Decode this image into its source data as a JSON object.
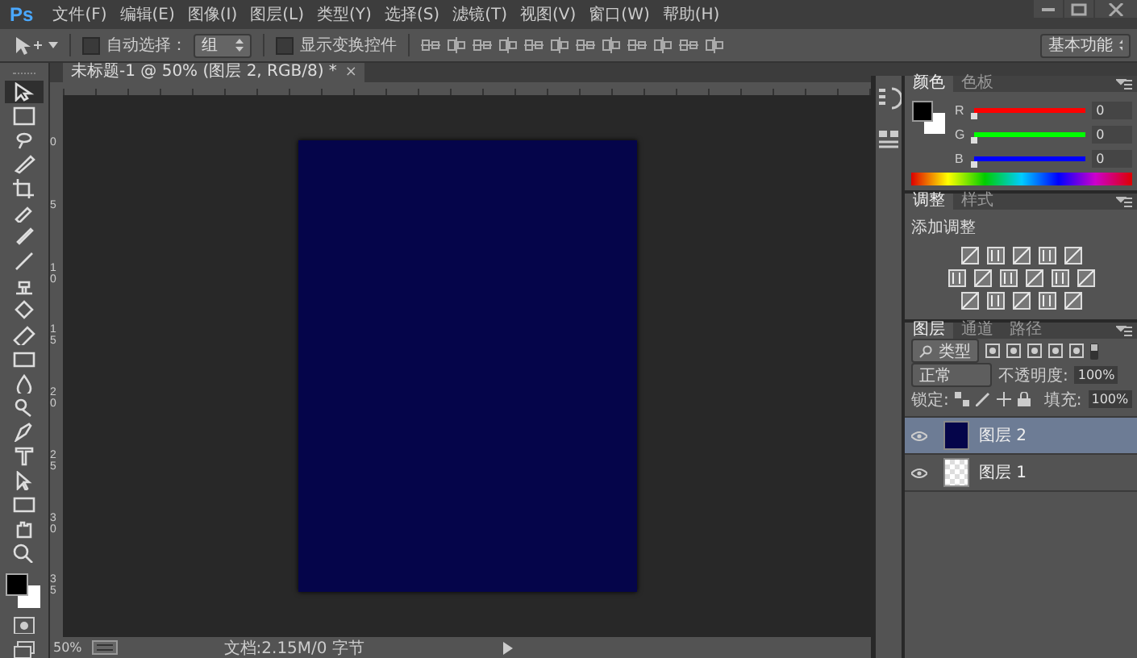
{
  "app_logo": "Ps",
  "menu": [
    "文件(F)",
    "编辑(E)",
    "图像(I)",
    "图层(L)",
    "类型(Y)",
    "选择(S)",
    "滤镜(T)",
    "视图(V)",
    "窗口(W)",
    "帮助(H)"
  ],
  "options_bar": {
    "auto_select": {
      "label": "自动选择：",
      "checked": false
    },
    "target": "组",
    "show_transform": {
      "label": "显示变换控件",
      "checked": false
    },
    "workspace": "基本功能"
  },
  "document_tab": {
    "title": "未标题-1 @ 50% (图层 2, RGB/8) *",
    "close": "×"
  },
  "tools": [
    {
      "selected": true
    },
    {
      "selected": false
    },
    {
      "selected": false
    },
    {
      "selected": false
    },
    {
      "selected": false
    },
    {
      "selected": false
    },
    {
      "selected": false
    },
    {
      "selected": false
    },
    {
      "selected": false
    },
    {
      "selected": false
    },
    {
      "selected": false
    },
    {
      "selected": false
    },
    {
      "selected": false
    },
    {
      "selected": false
    },
    {
      "selected": false
    },
    {
      "selected": false
    },
    {
      "selected": false
    },
    {
      "selected": false
    },
    {
      "selected": false
    },
    {
      "selected": false
    }
  ],
  "ruler_labels": [
    "0",
    "5",
    "10",
    "15",
    "20",
    "25",
    "30",
    "35"
  ],
  "color_panel": {
    "tabs": [
      {
        "label": "颜色",
        "selected": true
      },
      {
        "label": "色板",
        "selected": false
      }
    ],
    "channels": [
      {
        "name": "R",
        "value": "0",
        "level": 0,
        "color": "#ff0000"
      },
      {
        "name": "G",
        "value": "0",
        "level": 0,
        "color": "#00ff00"
      },
      {
        "name": "B",
        "value": "0",
        "level": 0,
        "color": "#0000ff"
      }
    ]
  },
  "adjustments_panel": {
    "tabs": [
      {
        "label": "调整",
        "selected": true
      },
      {
        "label": "样式",
        "selected": false
      }
    ],
    "heading": "添加调整"
  },
  "layers_panel": {
    "tabs": [
      {
        "label": "图层",
        "selected": true
      },
      {
        "label": "通道",
        "selected": false
      },
      {
        "label": "路径",
        "selected": false
      }
    ],
    "filter": "类型",
    "blend_mode": "正常",
    "opacity_label": "不透明度:",
    "opacity": "100%",
    "lock_label": "锁定:",
    "fill_label": "填充:",
    "fill": "100%",
    "layers": [
      {
        "name": "图层 2",
        "selected": true,
        "visible": true,
        "kind": "solid"
      },
      {
        "name": "图层 1",
        "selected": false,
        "visible": true,
        "kind": "transparent"
      }
    ]
  },
  "status_bar": {
    "zoom": "50%",
    "doc_info": "文档:2.15M/0 字节"
  }
}
